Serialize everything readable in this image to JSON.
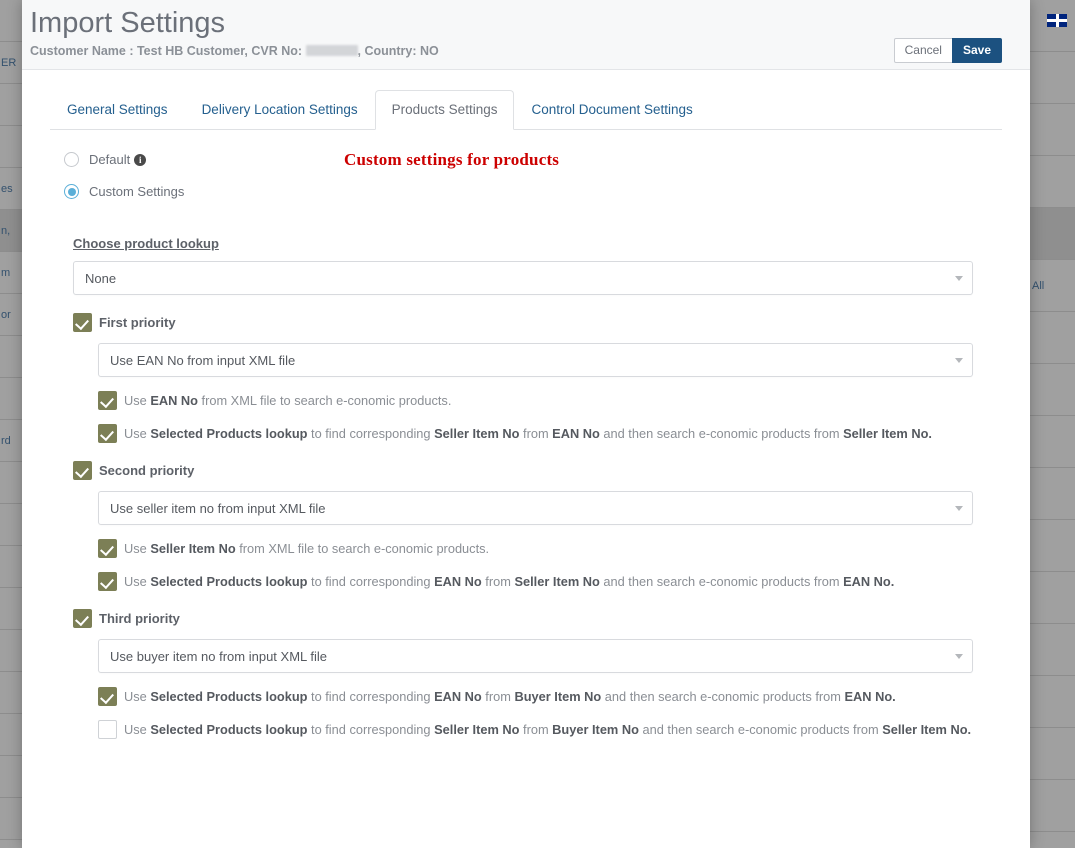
{
  "background": {
    "left_rows": [
      "",
      "ER",
      "",
      "",
      "es",
      "n,",
      "m",
      "or",
      "",
      "",
      "rd",
      "",
      "",
      "",
      "",
      "",
      "",
      "",
      "",
      ""
    ],
    "right_rows": [
      "",
      "",
      "",
      "",
      "",
      "All",
      "",
      "",
      "",
      "",
      "",
      "",
      "",
      "",
      "",
      ""
    ],
    "flag_icon": "uk-flag-icon"
  },
  "header": {
    "title": "Import Settings",
    "subtitle_prefix": "Customer Name : Test HB Customer, CVR No: ",
    "subtitle_suffix": ", Country: NO",
    "cancel_label": "Cancel",
    "save_label": "Save"
  },
  "tabs": [
    {
      "label": "General Settings",
      "active": false
    },
    {
      "label": "Delivery Location Settings",
      "active": false
    },
    {
      "label": "Products Settings",
      "active": true
    },
    {
      "label": "Control Document Settings",
      "active": false
    }
  ],
  "body": {
    "red_note": "Custom settings for products",
    "radio_default": "Default",
    "radio_default_info": "i",
    "radio_custom": "Custom Settings",
    "section_heading": "Choose product lookup",
    "product_lookup_value": "None"
  },
  "priorities": [
    {
      "label": "First priority",
      "checked": true,
      "select_value": "Use EAN No from input XML file",
      "options": [
        {
          "checked": true,
          "parts": [
            {
              "t": "Use ",
              "b": false
            },
            {
              "t": "EAN No",
              "b": true
            },
            {
              "t": " from XML file to search e-conomic products.",
              "b": false
            }
          ]
        },
        {
          "checked": true,
          "parts": [
            {
              "t": "Use ",
              "b": false
            },
            {
              "t": "Selected Products lookup",
              "b": true
            },
            {
              "t": " to find corresponding ",
              "b": false
            },
            {
              "t": "Seller Item No",
              "b": true
            },
            {
              "t": " from ",
              "b": false
            },
            {
              "t": "EAN No",
              "b": true
            },
            {
              "t": " and then search e-conomic products from ",
              "b": false
            },
            {
              "t": "Seller Item No.",
              "b": true
            }
          ]
        }
      ]
    },
    {
      "label": "Second priority",
      "checked": true,
      "select_value": "Use seller item no from input XML file",
      "options": [
        {
          "checked": true,
          "parts": [
            {
              "t": "Use ",
              "b": false
            },
            {
              "t": "Seller Item No",
              "b": true
            },
            {
              "t": " from XML file to search e-conomic products.",
              "b": false
            }
          ]
        },
        {
          "checked": true,
          "parts": [
            {
              "t": "Use ",
              "b": false
            },
            {
              "t": "Selected Products lookup",
              "b": true
            },
            {
              "t": " to find corresponding ",
              "b": false
            },
            {
              "t": "EAN No",
              "b": true
            },
            {
              "t": " from ",
              "b": false
            },
            {
              "t": "Seller Item No",
              "b": true
            },
            {
              "t": " and then search e-conomic products from ",
              "b": false
            },
            {
              "t": "EAN No.",
              "b": true
            }
          ]
        }
      ]
    },
    {
      "label": "Third priority",
      "checked": true,
      "select_value": "Use buyer item no from input XML file",
      "options": [
        {
          "checked": true,
          "parts": [
            {
              "t": "Use ",
              "b": false
            },
            {
              "t": "Selected Products lookup",
              "b": true
            },
            {
              "t": " to find corresponding ",
              "b": false
            },
            {
              "t": "EAN No",
              "b": true
            },
            {
              "t": " from ",
              "b": false
            },
            {
              "t": "Buyer Item No",
              "b": true
            },
            {
              "t": " and then search e-conomic products from ",
              "b": false
            },
            {
              "t": "EAN No.",
              "b": true
            }
          ]
        },
        {
          "checked": false,
          "parts": [
            {
              "t": "Use ",
              "b": false
            },
            {
              "t": "Selected Products lookup",
              "b": true
            },
            {
              "t": " to find corresponding ",
              "b": false
            },
            {
              "t": "Seller Item No",
              "b": true
            },
            {
              "t": " from ",
              "b": false
            },
            {
              "t": "Buyer Item No",
              "b": true
            },
            {
              "t": " and then search e-conomic products from ",
              "b": false
            },
            {
              "t": "Seller Item No.",
              "b": true
            }
          ]
        }
      ]
    }
  ],
  "colors": {
    "checkbox_on": "#7c7f56",
    "radio_on": "#5bafd8",
    "save_button": "#1c5180",
    "tab_link": "#25608f",
    "red_note": "#cc0000"
  }
}
